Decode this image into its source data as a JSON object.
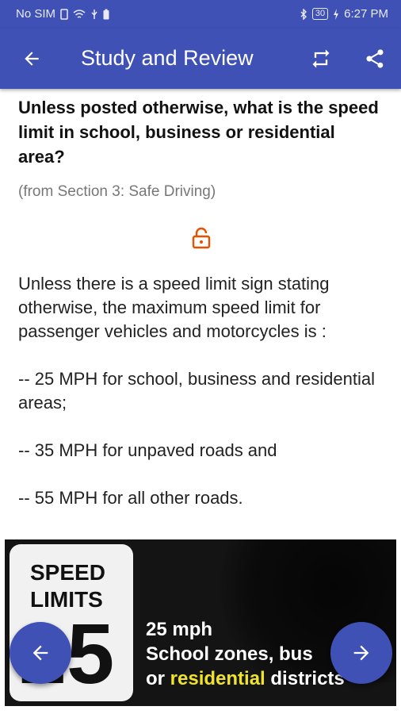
{
  "status_bar": {
    "carrier": "No SIM",
    "battery": "30",
    "time": "6:27 PM"
  },
  "app_bar": {
    "title": "Study and Review",
    "icons": [
      "back-arrow-icon",
      "repeat-icon",
      "share-icon"
    ]
  },
  "question": {
    "text": "Unless posted otherwise, what is the speed limit in school, business or residential area?",
    "source": "(from Section 3: Safe Driving)"
  },
  "answer": {
    "paragraphs": [
      "Unless there is a speed limit sign stating otherwise, the maximum speed limit for passenger vehicles and motorcycles is :",
      "-- 25 MPH for school, business and residential areas;",
      "-- 35 MPH for unpaved roads and",
      "-- 55 MPH for all other roads."
    ]
  },
  "illustration": {
    "sign_line1": "SPEED",
    "sign_line2": "LIMITS",
    "sign_number": "25",
    "caption_line1": "25 mph",
    "caption_line2": "School zones, bus",
    "caption_line3_prefix": "or ",
    "caption_line3_highlight": "residential",
    "caption_line3_suffix": " districts"
  },
  "nav": {
    "prev_icon": "arrow-left-icon",
    "next_icon": "arrow-right-icon"
  },
  "colors": {
    "primary": "#3f51b5",
    "lock": "#e65100",
    "highlight": "#f0e42a"
  }
}
